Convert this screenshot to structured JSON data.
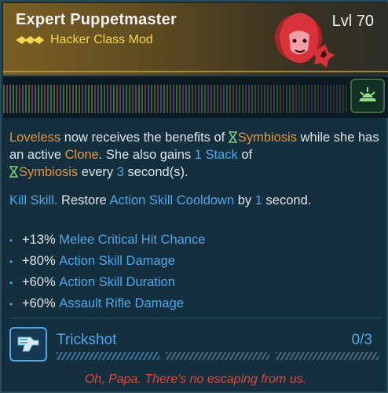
{
  "item": {
    "name": "Expert Puppetmaster",
    "type": "Hacker Class Mod",
    "level": "Lvl 70"
  },
  "description": {
    "line1": {
      "p1": "Loveless",
      "p2": " now receives the benefits of ",
      "p3": "Symbiosis",
      "p4": "  while she has an active ",
      "p5": "Clone",
      "p6": ". She also gains ",
      "p7": "1 Stack",
      "p8": " of ",
      "p9": "Symbiosis",
      "p10": " every ",
      "p11": "3",
      "p12": " second(s)."
    },
    "line2": {
      "p1": "Kill Skill.",
      "p2": " Restore ",
      "p3": "Action Skill Cooldown",
      "p4": " by ",
      "p5": "1",
      "p6": " second."
    }
  },
  "stats": [
    {
      "value": "+13%",
      "label": "Melee Critical Hit Chance"
    },
    {
      "value": "+80%",
      "label": "Action Skill Damage"
    },
    {
      "value": "+60%",
      "label": "Action Skill Duration"
    },
    {
      "value": "+60%",
      "label": "Assault Rifle Damage"
    }
  ],
  "skill": {
    "name": "Trickshot",
    "points": "0/3",
    "rank_fraction": 0
  },
  "flavor_text": "Oh, Papa. There's no escaping from us.",
  "colors": {
    "keyword_orange": "#e8953a",
    "stat_blue": "#4fa7e8",
    "title_gold": "#f5d64a",
    "flavor_red": "#e0453a"
  },
  "icons": {
    "portrait": "character-portrait-icon",
    "rarity": "rarity-chevrons-icon",
    "skill_badge": "class-skill-icon",
    "trickshot": "trickshot-skill-icon",
    "hourglass": "hourglass-icon"
  }
}
